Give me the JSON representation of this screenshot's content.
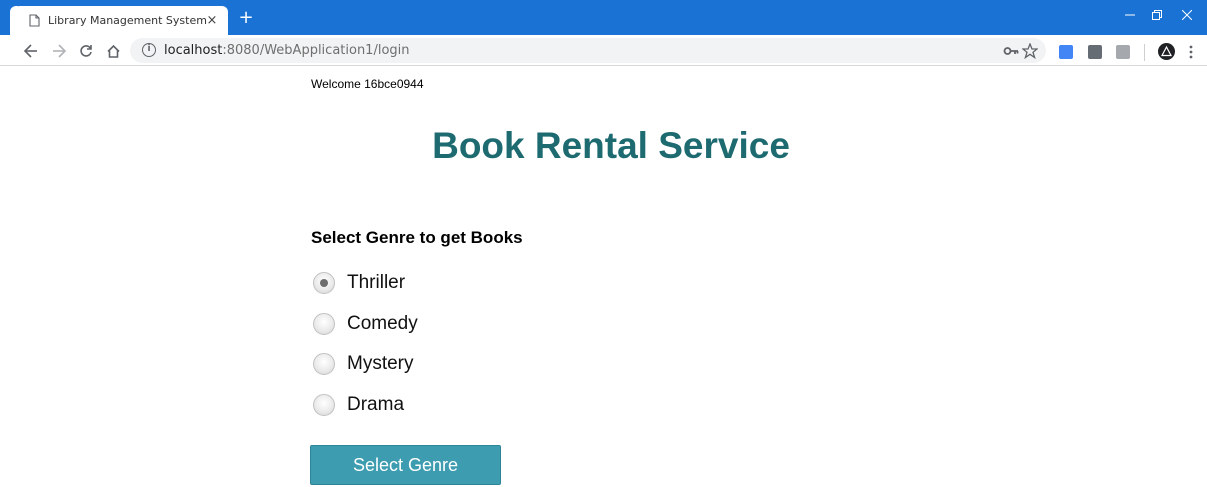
{
  "browser": {
    "tab_title": "Library Management System",
    "tab_close": "×",
    "new_tab": "+",
    "url_host": "localhost",
    "url_path": ":8080/WebApplication1/login",
    "info_symbol": "i",
    "accent_color": "#1a73d4"
  },
  "page": {
    "welcome": "Welcome 16bce0944",
    "title": "Book Rental Service",
    "title_color": "#1d6a70",
    "subheading": "Select Genre to get Books",
    "genres": [
      {
        "label": "Thriller",
        "checked": true
      },
      {
        "label": "Comedy",
        "checked": false
      },
      {
        "label": "Mystery",
        "checked": false
      },
      {
        "label": "Drama",
        "checked": false
      }
    ],
    "submit_label": "Select Genre",
    "button_color": "#3e9cb0"
  }
}
